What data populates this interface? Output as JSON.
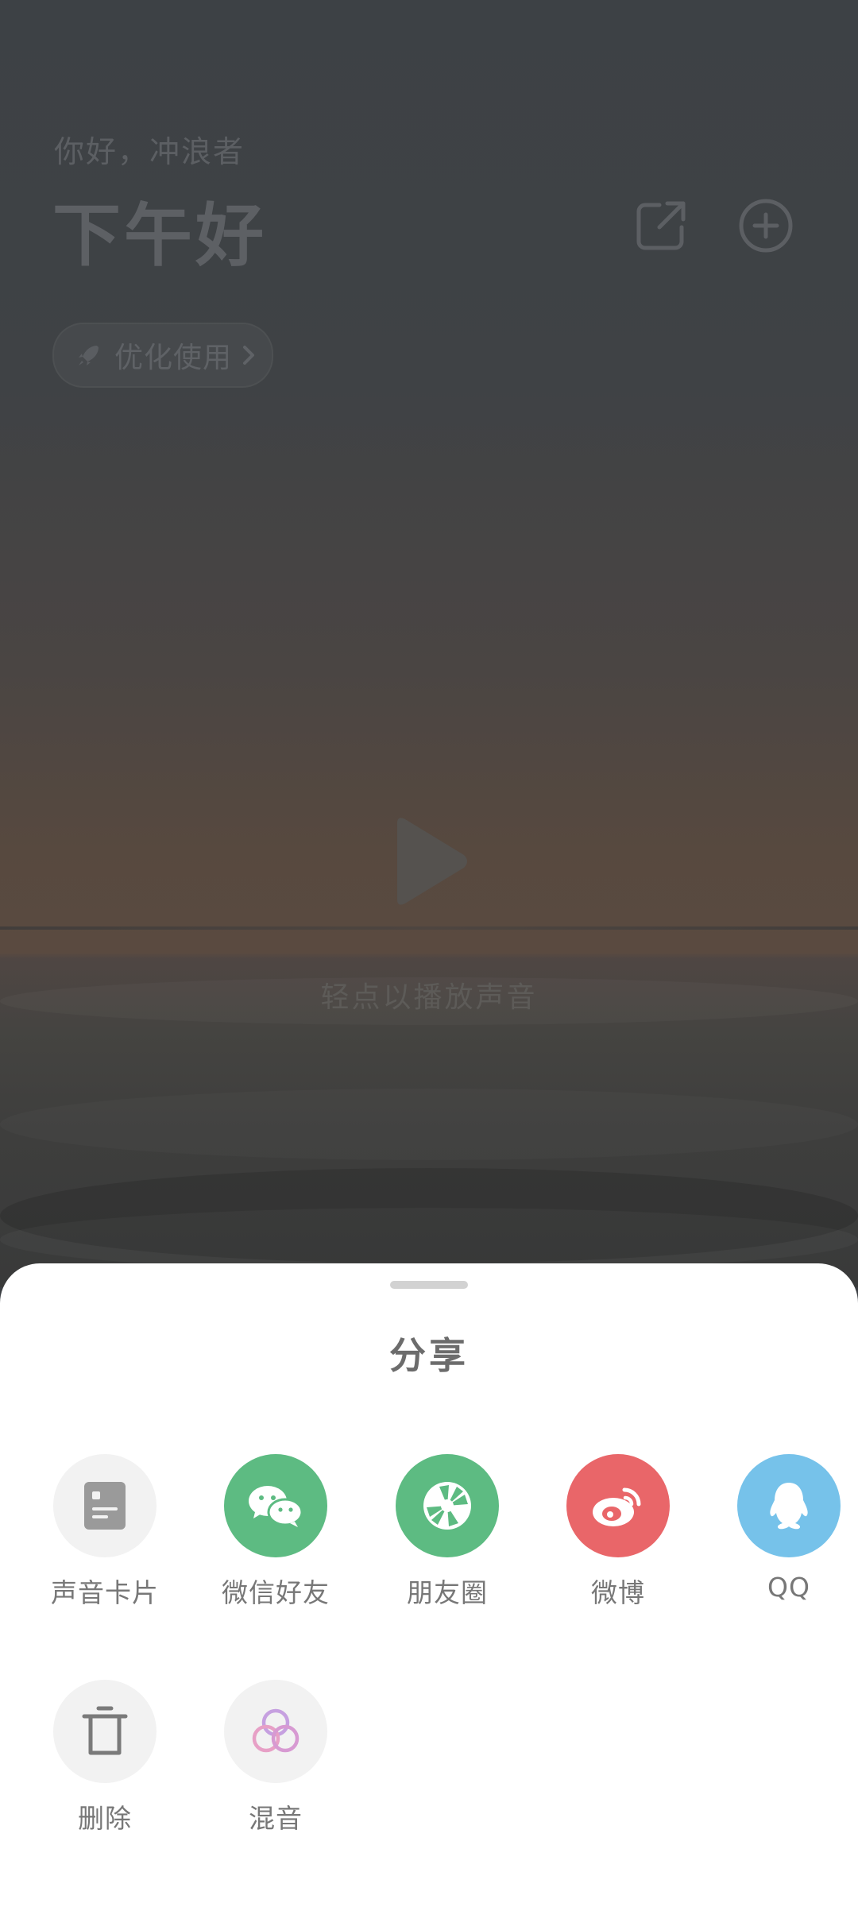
{
  "header": {
    "greeting_sub": "你好，冲浪者",
    "greeting_title": "下午好"
  },
  "optimize": {
    "label": "优化使用"
  },
  "player": {
    "hint": "轻点以播放声音"
  },
  "sheet": {
    "title": "分享",
    "items": [
      {
        "label": "声音卡片",
        "icon": "sound-card-icon",
        "color": "#f2f2f2",
        "icon_color": "#9a9a9a"
      },
      {
        "label": "微信好友",
        "icon": "wechat-icon",
        "color": "#5dbb82",
        "icon_color": "#ffffff"
      },
      {
        "label": "朋友圈",
        "icon": "moments-icon",
        "color": "#5dbb82",
        "icon_color": "#ffffff"
      },
      {
        "label": "微博",
        "icon": "weibo-icon",
        "color": "#e96669",
        "icon_color": "#ffffff"
      },
      {
        "label": "QQ",
        "icon": "qq-icon",
        "color": "#76c2ea",
        "icon_color": "#ffffff"
      },
      {
        "label": "删除",
        "icon": "trash-icon",
        "color": "#f2f2f2",
        "icon_color": "#7a7a7a"
      },
      {
        "label": "混音",
        "icon": "mix-icon",
        "color": "#f2f2f2",
        "icon_color": "#c79ad6"
      }
    ]
  }
}
